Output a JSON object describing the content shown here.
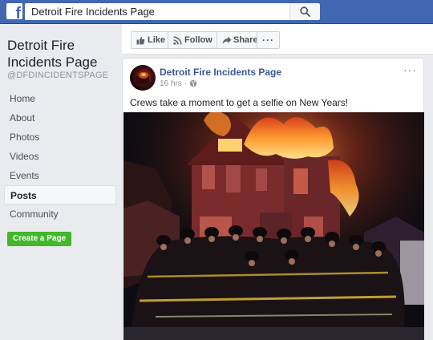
{
  "topbar": {
    "logo_letter": "f",
    "search_value": "Detroit Fire Incidents Page"
  },
  "sidebar": {
    "title": "Detroit Fire Incidents Page",
    "handle": "@DFDINCIDENTSPAGE",
    "items": [
      {
        "label": "Home"
      },
      {
        "label": "About"
      },
      {
        "label": "Photos"
      },
      {
        "label": "Videos"
      },
      {
        "label": "Events"
      },
      {
        "label": "Posts",
        "active": true
      },
      {
        "label": "Community"
      }
    ],
    "create_label": "Create a Page"
  },
  "actions": {
    "like": "Like",
    "follow": "Follow",
    "share": "Share",
    "more": "···"
  },
  "post": {
    "author": "Detroit Fire Incidents Page",
    "time": "16 hrs",
    "options": "···",
    "text": "Crews take a moment to get a selfie on New Years!"
  },
  "colors": {
    "brand": "#4267b2",
    "link": "#385898",
    "create_button": "#42b72a"
  }
}
